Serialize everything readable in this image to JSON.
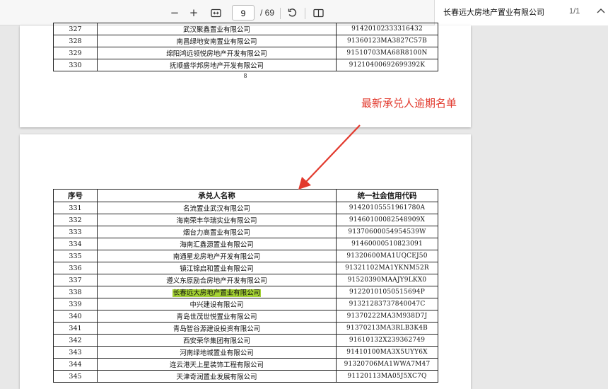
{
  "toolbar": {
    "zoom_out": "−",
    "zoom_in": "+",
    "fit_icon": "fit-page-icon",
    "current_page": "9",
    "page_total": "/ 69",
    "rotate_icon": "rotate-icon",
    "two_page_icon": "two-page-view-icon"
  },
  "find": {
    "query": "长春远大房地产置业有限公司",
    "count": "1/1",
    "up_icon": "chevron-up-icon"
  },
  "page8": {
    "page_number": "8",
    "rows": [
      {
        "no": "327",
        "name": "武汉聚鑫置业有限公司",
        "code": "91420102333316432"
      },
      {
        "no": "328",
        "name": "南昌绿地安南置业有限公司",
        "code": "91360123MA3827C57B"
      },
      {
        "no": "329",
        "name": "绵阳鸿远领悦房地产开发有限公司",
        "code": "91510703MA68R8100N"
      },
      {
        "no": "330",
        "name": "抚顺盛华邦房地产开发有限公司",
        "code": "91210400692699392K"
      }
    ]
  },
  "annotation": {
    "text": "最新承兑人逾期名单",
    "color": "#e23a2e"
  },
  "page9": {
    "headers": {
      "no": "序号",
      "name": "承兑人名称",
      "code": "统一社会信用代码"
    },
    "highlight_color": "#a3d133",
    "rows": [
      {
        "no": "331",
        "name": "名流置业武汉有限公司",
        "code": "91420105551961780A"
      },
      {
        "no": "332",
        "name": "海南荣丰华瑞实业有限公司",
        "code": "91460100082548909X"
      },
      {
        "no": "333",
        "name": "烟台力高置业有限公司",
        "code": "91370600054954539W"
      },
      {
        "no": "334",
        "name": "海南汇鑫源置业有限公司",
        "code": "91460000510823091"
      },
      {
        "no": "335",
        "name": "南通星龙房地产开发有限公司",
        "code": "91320600MA1UQCEJ50"
      },
      {
        "no": "336",
        "name": "镇江锦启和置业有限公司",
        "code": "91321102MA1YKNM52R"
      },
      {
        "no": "337",
        "name": "遵义东原励合房地产开发有限公司",
        "code": "91520390MAAJY9LKX0"
      },
      {
        "no": "338",
        "name": "长春远大房地产置业有限公司",
        "code": "91220101050515694P"
      },
      {
        "no": "339",
        "name": "中兴建设有限公司",
        "code": "91321283737840047C"
      },
      {
        "no": "340",
        "name": "青岛世茂世悦置业有限公司",
        "code": "91370222MA3M938D7J"
      },
      {
        "no": "341",
        "name": "青岛智谷源建设投资有限公司",
        "code": "91370213MA3RLB3K4B"
      },
      {
        "no": "342",
        "name": "西安荣华集团有限公司",
        "code": "91610132X239362749"
      },
      {
        "no": "343",
        "name": "河南绿地城置业有限公司",
        "code": "91410100MA3X5UYY6X"
      },
      {
        "no": "344",
        "name": "连云港天上星装饰工程有限公司",
        "code": "91320706MA1WWA7M47"
      },
      {
        "no": "345",
        "name": "天津奇润置业发展有限公司",
        "code": "91120113MA05J5XC7Q"
      }
    ]
  }
}
